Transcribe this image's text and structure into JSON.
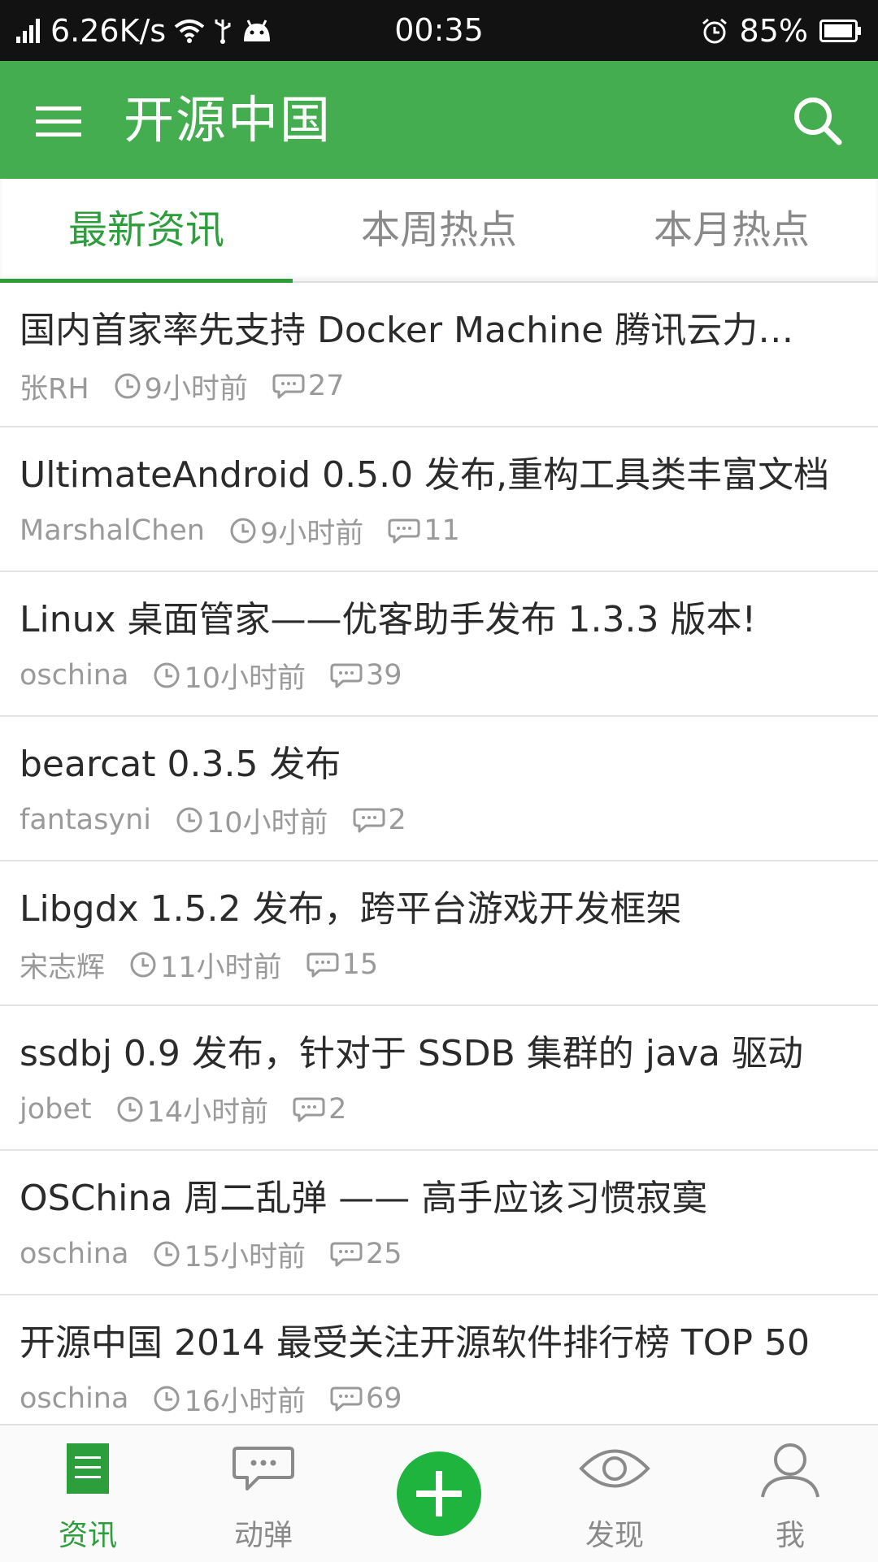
{
  "status_bar": {
    "net_speed": "6.26K/s",
    "time": "00:35",
    "battery": "85%"
  },
  "app_bar": {
    "title": "开源中国"
  },
  "tabs": [
    {
      "label": "最新资讯",
      "active": true
    },
    {
      "label": "本周热点",
      "active": false
    },
    {
      "label": "本月热点",
      "active": false
    }
  ],
  "news": [
    {
      "title": "国内首家率先支持 Docker Machine 腾讯云力…",
      "author": "张RH",
      "time": "9小时前",
      "comments": "27"
    },
    {
      "title": "UltimateAndroid 0.5.0 发布,重构工具类丰富文档",
      "author": "MarshalChen",
      "time": "9小时前",
      "comments": "11"
    },
    {
      "title": "Linux 桌面管家——优客助手发布 1.3.3 版本!",
      "author": "oschina",
      "time": "10小时前",
      "comments": "39"
    },
    {
      "title": "bearcat 0.3.5 发布",
      "author": "fantasyni",
      "time": "10小时前",
      "comments": "2"
    },
    {
      "title": "Libgdx 1.5.2 发布，跨平台游戏开发框架",
      "author": "宋志辉",
      "time": "11小时前",
      "comments": "15"
    },
    {
      "title": "ssdbj 0.9 发布，针对于 SSDB 集群的 java 驱动",
      "author": "jobet",
      "time": "14小时前",
      "comments": "2"
    },
    {
      "title": "OSChina 周二乱弹 —— 高手应该习惯寂寞",
      "author": "oschina",
      "time": "15小时前",
      "comments": "25"
    },
    {
      "title": "开源中国 2014 最受关注开源软件排行榜 TOP 50",
      "author": "oschina",
      "time": "16小时前",
      "comments": "69"
    }
  ],
  "bottom_nav": [
    {
      "label": "资讯",
      "icon": "news-icon",
      "active": true
    },
    {
      "label": "动弹",
      "icon": "chat-bubble-icon",
      "active": false
    },
    {
      "label": "",
      "icon": "plus-icon",
      "active": false
    },
    {
      "label": "发现",
      "icon": "eye-icon",
      "active": false
    },
    {
      "label": "我",
      "icon": "user-icon",
      "active": false
    }
  ],
  "colors": {
    "primary": "#44ad4f",
    "accent": "#2c9e3b",
    "fab": "#1fb43e"
  }
}
